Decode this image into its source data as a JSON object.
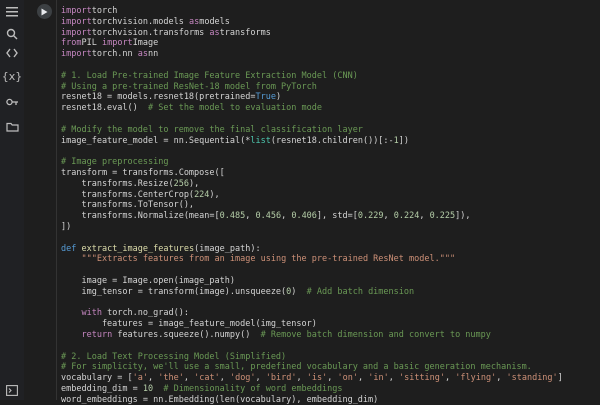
{
  "sidebar": {
    "icons": [
      "menu-icon",
      "search-icon",
      "code-icon",
      "variables-icon",
      "key-icon",
      "folder-icon",
      "terminal-icon"
    ],
    "variables_label": "{x}"
  },
  "cell": {
    "run_label": "run cell"
  },
  "code_lines": [
    [
      [
        "kw",
        "import"
      ],
      [
        "",
        "torch"
      ]
    ],
    [
      [
        "kw",
        "import"
      ],
      [
        "",
        "torchvision.models "
      ],
      [
        "kw",
        "as"
      ],
      [
        "",
        "models"
      ]
    ],
    [
      [
        "kw",
        "import"
      ],
      [
        "",
        "torchvision.transforms "
      ],
      [
        "kw",
        "as"
      ],
      [
        "",
        "transforms"
      ]
    ],
    [
      [
        "kw",
        "from"
      ],
      [
        "",
        "PIL "
      ],
      [
        "kw",
        "import"
      ],
      [
        "",
        "Image"
      ]
    ],
    [
      [
        "kw",
        "import"
      ],
      [
        "",
        "torch.nn "
      ],
      [
        "kw",
        "as"
      ],
      [
        "",
        "nn"
      ]
    ],
    [],
    [
      [
        "cm",
        "# 1. Load Pre-trained Image Feature Extraction Model (CNN)"
      ]
    ],
    [
      [
        "cm",
        "# Using a pre-trained ResNet-18 model from PyTorch"
      ]
    ],
    [
      [
        "",
        "resnet18 = models.resnet18(pretrained="
      ],
      [
        "const",
        "True"
      ],
      [
        "",
        ")"
      ]
    ],
    [
      [
        "",
        "resnet18.eval()  "
      ],
      [
        "cm",
        "# Set the model to evaluation mode"
      ]
    ],
    [],
    [
      [
        "cm",
        "# Modify the model to remove the final classification layer"
      ]
    ],
    [
      [
        "",
        "image_feature_model = nn.Sequential(*"
      ],
      [
        "cls",
        "list"
      ],
      [
        "",
        "(resnet18.children())[:-"
      ],
      [
        "num",
        "1"
      ],
      [
        "",
        "])"
      ]
    ],
    [],
    [
      [
        "cm",
        "# Image preprocessing"
      ]
    ],
    [
      [
        "",
        "transform = transforms.Compose(["
      ]
    ],
    [
      [
        "",
        "    transforms.Resize("
      ],
      [
        "num",
        "256"
      ],
      [
        "",
        "),"
      ]
    ],
    [
      [
        "",
        "    transforms.CenterCrop("
      ],
      [
        "num",
        "224"
      ],
      [
        "",
        "),"
      ]
    ],
    [
      [
        "",
        "    transforms.ToTensor(),"
      ]
    ],
    [
      [
        "",
        "    transforms.Normalize(mean=["
      ],
      [
        "num",
        "0.485"
      ],
      [
        "",
        ", "
      ],
      [
        "num",
        "0.456"
      ],
      [
        "",
        ", "
      ],
      [
        "num",
        "0.406"
      ],
      [
        "",
        "], std=["
      ],
      [
        "num",
        "0.229"
      ],
      [
        "",
        ", "
      ],
      [
        "num",
        "0.224"
      ],
      [
        "",
        ", "
      ],
      [
        "num",
        "0.225"
      ],
      [
        "",
        "]),"
      ]
    ],
    [
      [
        "",
        "])"
      ]
    ],
    [],
    [
      [
        "kw2",
        "def"
      ],
      [
        "",
        " "
      ],
      [
        "fn",
        "extract_image_features"
      ],
      [
        "",
        "(image_path):"
      ]
    ],
    [
      [
        "",
        "    "
      ],
      [
        "str",
        "\"\"\"Extracts features from an image using the pre-trained ResNet model.\"\"\""
      ]
    ],
    [],
    [
      [
        "",
        "    image = Image.open(image_path)"
      ]
    ],
    [
      [
        "",
        "    img_tensor = transform(image).unsqueeze("
      ],
      [
        "num",
        "0"
      ],
      [
        "",
        ")  "
      ],
      [
        "cm",
        "# Add batch dimension"
      ]
    ],
    [],
    [
      [
        "",
        "    "
      ],
      [
        "kw",
        "with"
      ],
      [
        "",
        " torch.no_grad():"
      ]
    ],
    [
      [
        "",
        "        features = image_feature_model(img_tensor)"
      ]
    ],
    [
      [
        "",
        "    "
      ],
      [
        "kw",
        "return"
      ],
      [
        "",
        " features.squeeze().numpy()  "
      ],
      [
        "cm",
        "# Remove batch dimension and convert to numpy"
      ]
    ],
    [],
    [
      [
        "cm",
        "# 2. Load Text Processing Model (Simplified)"
      ]
    ],
    [
      [
        "cm",
        "# For simplicity, we'll use a small, predefined vocabulary and a basic generation mechanism."
      ]
    ],
    [
      [
        "",
        "vocabulary = ["
      ],
      [
        "str",
        "'a'"
      ],
      [
        "",
        ", "
      ],
      [
        "str",
        "'the'"
      ],
      [
        "",
        ", "
      ],
      [
        "str",
        "'cat'"
      ],
      [
        "",
        ", "
      ],
      [
        "str",
        "'dog'"
      ],
      [
        "",
        ", "
      ],
      [
        "str",
        "'bird'"
      ],
      [
        "",
        ", "
      ],
      [
        "str",
        "'is'"
      ],
      [
        "",
        ", "
      ],
      [
        "str",
        "'on'"
      ],
      [
        "",
        ", "
      ],
      [
        "str",
        "'in'"
      ],
      [
        "",
        ", "
      ],
      [
        "str",
        "'sitting'"
      ],
      [
        "",
        ", "
      ],
      [
        "str",
        "'flying'"
      ],
      [
        "",
        ", "
      ],
      [
        "str",
        "'standing'"
      ],
      [
        "",
        "]"
      ]
    ],
    [
      [
        "",
        "embedding_dim = "
      ],
      [
        "num",
        "10"
      ],
      [
        "",
        "  "
      ],
      [
        "cm",
        "# Dimensionality of word embeddings"
      ]
    ],
    [
      [
        "",
        "word_embeddings = nn.Embedding(len(vocabulary), embedding_dim)"
      ]
    ]
  ]
}
